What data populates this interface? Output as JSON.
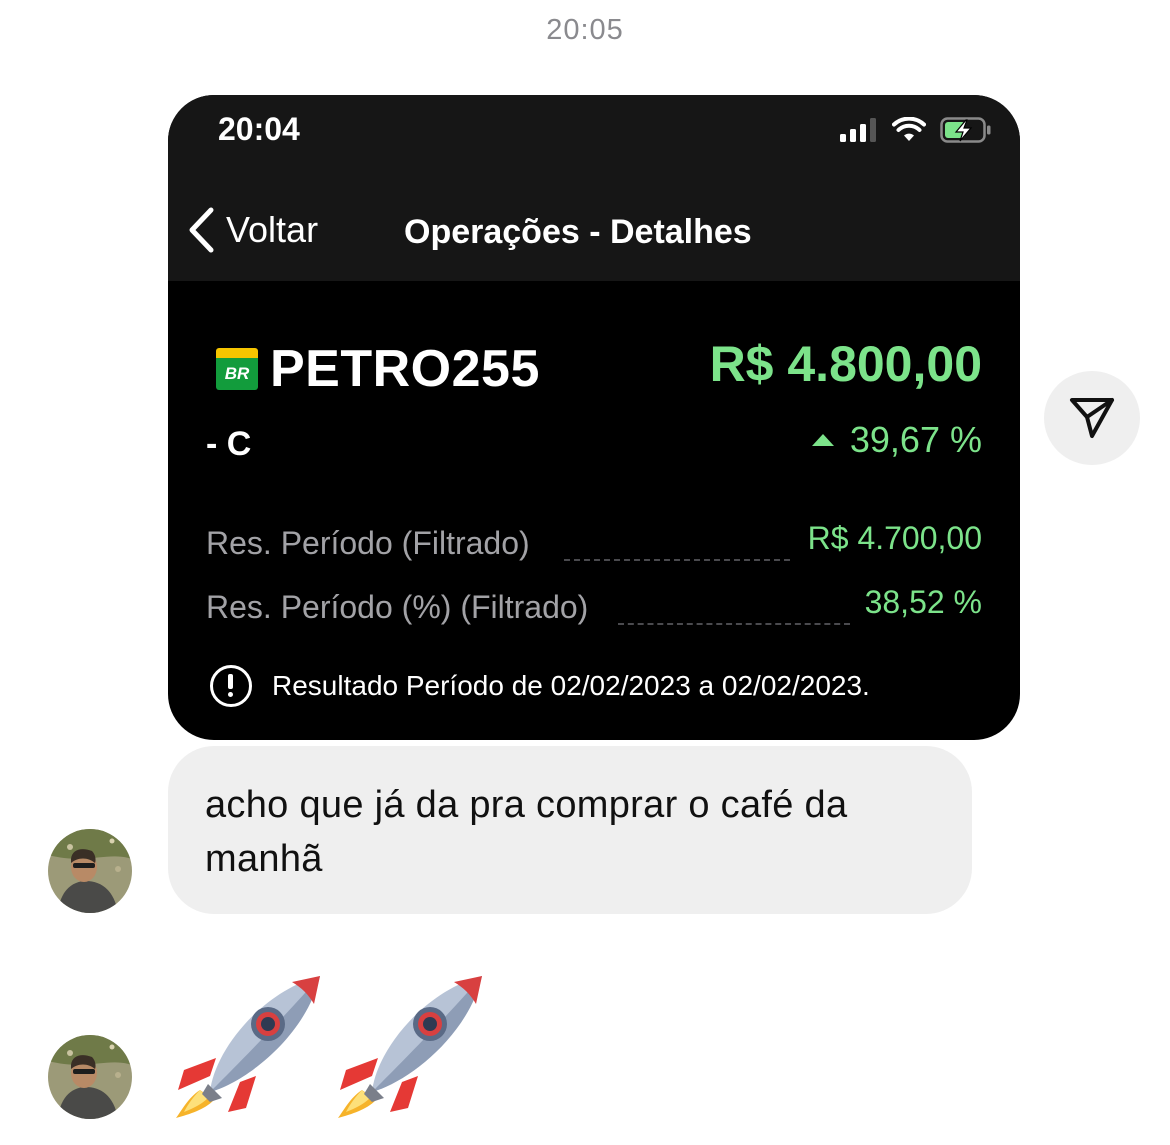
{
  "chat": {
    "timestamp": "20:05",
    "message_text": "acho que já da pra comprar o café da manhã",
    "emoji_message": [
      "rocket-emoji",
      "rocket-emoji"
    ]
  },
  "screenshot": {
    "status_time": "20:04",
    "nav": {
      "back_label": "Voltar",
      "title": "Operações - Detalhes"
    },
    "ticker": "PETRO255",
    "ticker_sub": "- C",
    "logo_text": "BR",
    "amount": "R$ 4.800,00",
    "change_pct": "39,67 %",
    "rows": [
      {
        "label": "Res. Período (Filtrado)",
        "value": "R$ 4.700,00"
      },
      {
        "label": "Res. Período (%) (Filtrado)",
        "value": "38,52 %"
      }
    ],
    "info_text": "Resultado Período de 02/02/2023 a 02/02/2023.",
    "colors": {
      "positive": "#7ce38a",
      "card_bg": "#000000",
      "bar_bg": "#161616"
    }
  },
  "icons": {
    "share": "paper-plane-icon",
    "signal": "signal-bars-icon",
    "wifi": "wifi-icon",
    "battery": "battery-charging-icon",
    "back": "chevron-left-icon",
    "info": "exclamation-circle-icon"
  }
}
